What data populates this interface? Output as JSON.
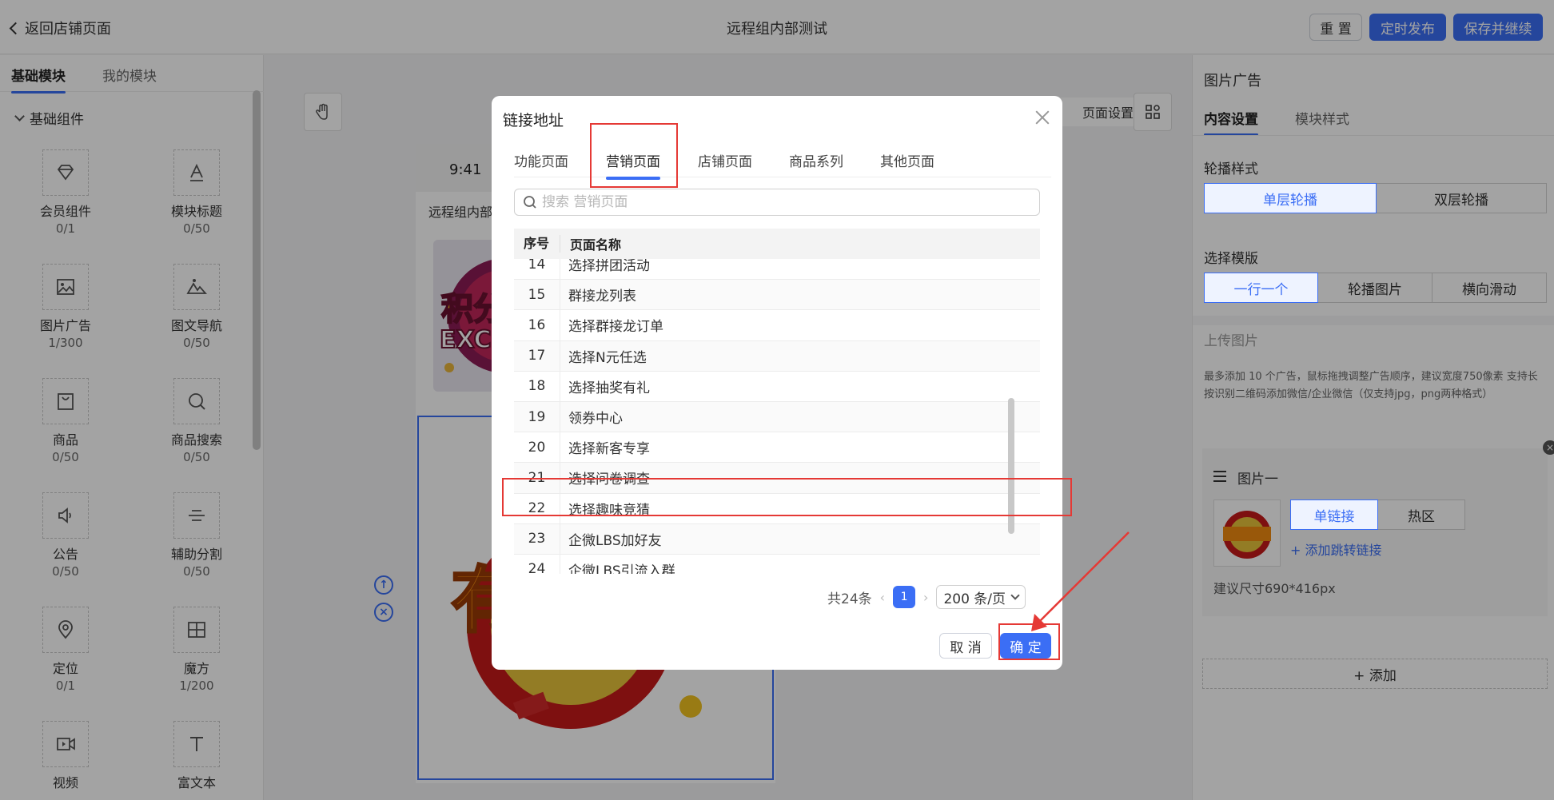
{
  "header": {
    "back_label": "返回店铺页面",
    "title": "远程组内部测试",
    "reset_label": "重 置",
    "schedule_label": "定时发布",
    "save_label": "保存并继续",
    "accent_color": "#3b6ef5"
  },
  "left_panel": {
    "tabs": [
      "基础模块",
      "我的模块"
    ],
    "group_label": "基础组件",
    "widgets": [
      {
        "name": "会员组件",
        "count": "0/1",
        "icon": "diamond-icon"
      },
      {
        "name": "模块标题",
        "count": "0/50",
        "icon": "title-icon"
      },
      {
        "name": "图片广告",
        "count": "1/300",
        "icon": "image-icon"
      },
      {
        "name": "图文导航",
        "count": "0/50",
        "icon": "mountain-icon"
      },
      {
        "name": "商品",
        "count": "0/50",
        "icon": "shopping-bag-icon"
      },
      {
        "name": "商品搜索",
        "count": "0/50",
        "icon": "search-icon"
      },
      {
        "name": "公告",
        "count": "0/50",
        "icon": "speaker-icon"
      },
      {
        "name": "辅助分割",
        "count": "0/50",
        "icon": "divider-icon"
      },
      {
        "name": "定位",
        "count": "0/1",
        "icon": "location-icon"
      },
      {
        "name": "魔方",
        "count": "1/200",
        "icon": "grid-icon"
      },
      {
        "name": "视频",
        "count": "",
        "icon": "video-icon"
      },
      {
        "name": "富文本",
        "count": "",
        "icon": "text-icon"
      }
    ]
  },
  "canvas": {
    "page_settings_label": "页面设置",
    "phone_time": "9:41",
    "phone_shop_name": "远程组内部测试"
  },
  "right_panel": {
    "title": "图片广告",
    "tabs": [
      "内容设置",
      "模块样式"
    ],
    "carousel_label": "轮播样式",
    "carousel_options": [
      "单层轮播",
      "双层轮播"
    ],
    "template_label": "选择模版",
    "template_options": [
      "一行一个",
      "轮播图片",
      "横向滑动"
    ],
    "upload_label": "上传图片",
    "upload_tip": "最多添加 10 个广告，鼠标拖拽调整广告顺序，建议宽度750像素 支持长按识别二维码添加微信/企业微信（仅支持jpg，png两种格式）",
    "image_item": {
      "name": "图片一",
      "link_types": [
        "单链接",
        "热区"
      ],
      "add_link_label": "+ 添加跳转链接",
      "size_hint": "建议尺寸690*416px"
    },
    "add_label": "+ 添加"
  },
  "modal": {
    "title": "链接地址",
    "tabs": [
      "功能页面",
      "营销页面",
      "店铺页面",
      "商品系列",
      "其他页面"
    ],
    "search_placeholder": "搜索 营销页面",
    "columns": [
      "序号",
      "页面名称"
    ],
    "rows": [
      {
        "no": "14",
        "name": "选择拼团活动"
      },
      {
        "no": "15",
        "name": "群接龙列表"
      },
      {
        "no": "16",
        "name": "选择群接龙订单"
      },
      {
        "no": "17",
        "name": "选择N元任选"
      },
      {
        "no": "18",
        "name": "选择抽奖有礼"
      },
      {
        "no": "19",
        "name": "领券中心"
      },
      {
        "no": "20",
        "name": "选择新客专享"
      },
      {
        "no": "21",
        "name": "选择问卷调查"
      },
      {
        "no": "22",
        "name": "选择趣味竞猜"
      },
      {
        "no": "23",
        "name": "企微LBS加好友"
      },
      {
        "no": "24",
        "name": "企微LBS引流入群"
      }
    ],
    "total_label": "共24条",
    "current_page": "1",
    "page_size_label": "200 条/页",
    "cancel_label": "取 消",
    "ok_label": "确 定"
  }
}
